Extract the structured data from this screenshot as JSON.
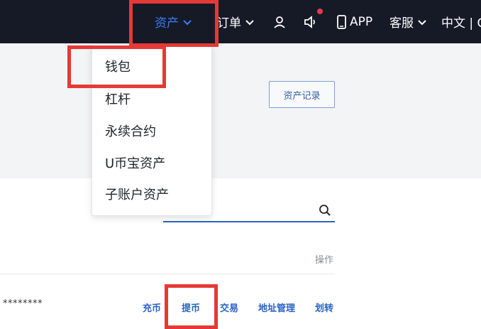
{
  "nav": {
    "assets": "资产",
    "orders": "订单",
    "app": "APP",
    "service": "客服",
    "lang": "中文 | C"
  },
  "icons": {
    "assets_chevron": "chevron-down-icon",
    "orders_chevron": "chevron-down-icon",
    "service_chevron": "chevron-down-icon",
    "user": "user-icon",
    "sound": "speaker-icon",
    "phone": "phone-icon",
    "search": "search-icon"
  },
  "dropdown": {
    "items": [
      "钱包",
      "杠杆",
      "永续合约",
      "U币宝资产",
      "子账户资产"
    ]
  },
  "asset_record_button": "资产记录",
  "table": {
    "operation_header": "操作",
    "rows": [
      {
        "masked_value": "********",
        "actions": [
          "充币",
          "提币",
          "交易",
          "地址管理",
          "划转"
        ]
      }
    ]
  },
  "colors": {
    "topbar": "#161a27",
    "accent": "#3b7cf6",
    "link": "#2b63c5",
    "highlight": "#e53935",
    "notification_dot": "#e53a48"
  }
}
